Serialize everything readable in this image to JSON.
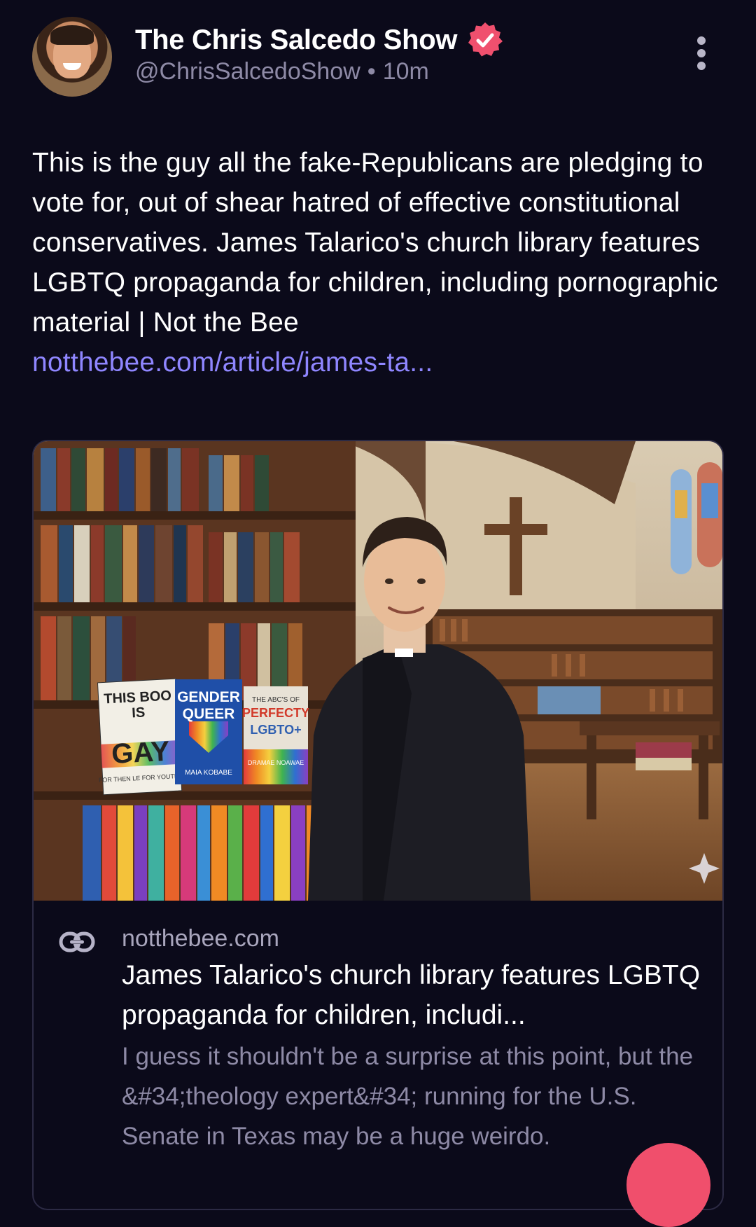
{
  "author": {
    "display_name": "The Chris Salcedo Show",
    "handle": "@ChrisSalcedoShow",
    "separator": "•",
    "timestamp": "10m",
    "verified": true,
    "avatar_icon": "user-avatar-photo"
  },
  "post": {
    "text": "This is the guy all the fake-Republicans are pledging to vote for, out of shear hatred of effective constitutional conservatives. James Talarico's church library features LGBTQ propaganda for children, including pornographic material | Not the Bee",
    "link_text": "notthebee.com/article/james-ta..."
  },
  "link_card": {
    "image_books": {
      "book1_line1": "THIS BOO",
      "book1_line2": "IS",
      "book1_line3": "GAY",
      "book1_sub": "FOR THEN LE FOR YOUTH U",
      "book2_line1": "GENDER",
      "book2_line2": "QUEER",
      "book2_author": "MAIA KOBABE",
      "book3_line1": "THE ABC'S OF",
      "book3_line2": "PERFECTY",
      "book3_line3": "LGBTO+",
      "book3_author": "DRAMAE NOAWAE"
    },
    "domain": "notthebee.com",
    "title": "James Talarico's church library features LGBTQ propaganda for children, includi...",
    "description": "I guess it shouldn't be a surprise at this point, but the &#34;theology expert&#34; running for the U.S. Senate in Texas may be a huge weirdo."
  },
  "colors": {
    "background": "#0b0a1a",
    "verified_badge": "#f0506e",
    "link": "#8f86ff",
    "muted_text": "#8e8aa6",
    "fab": "#f04f6c"
  }
}
